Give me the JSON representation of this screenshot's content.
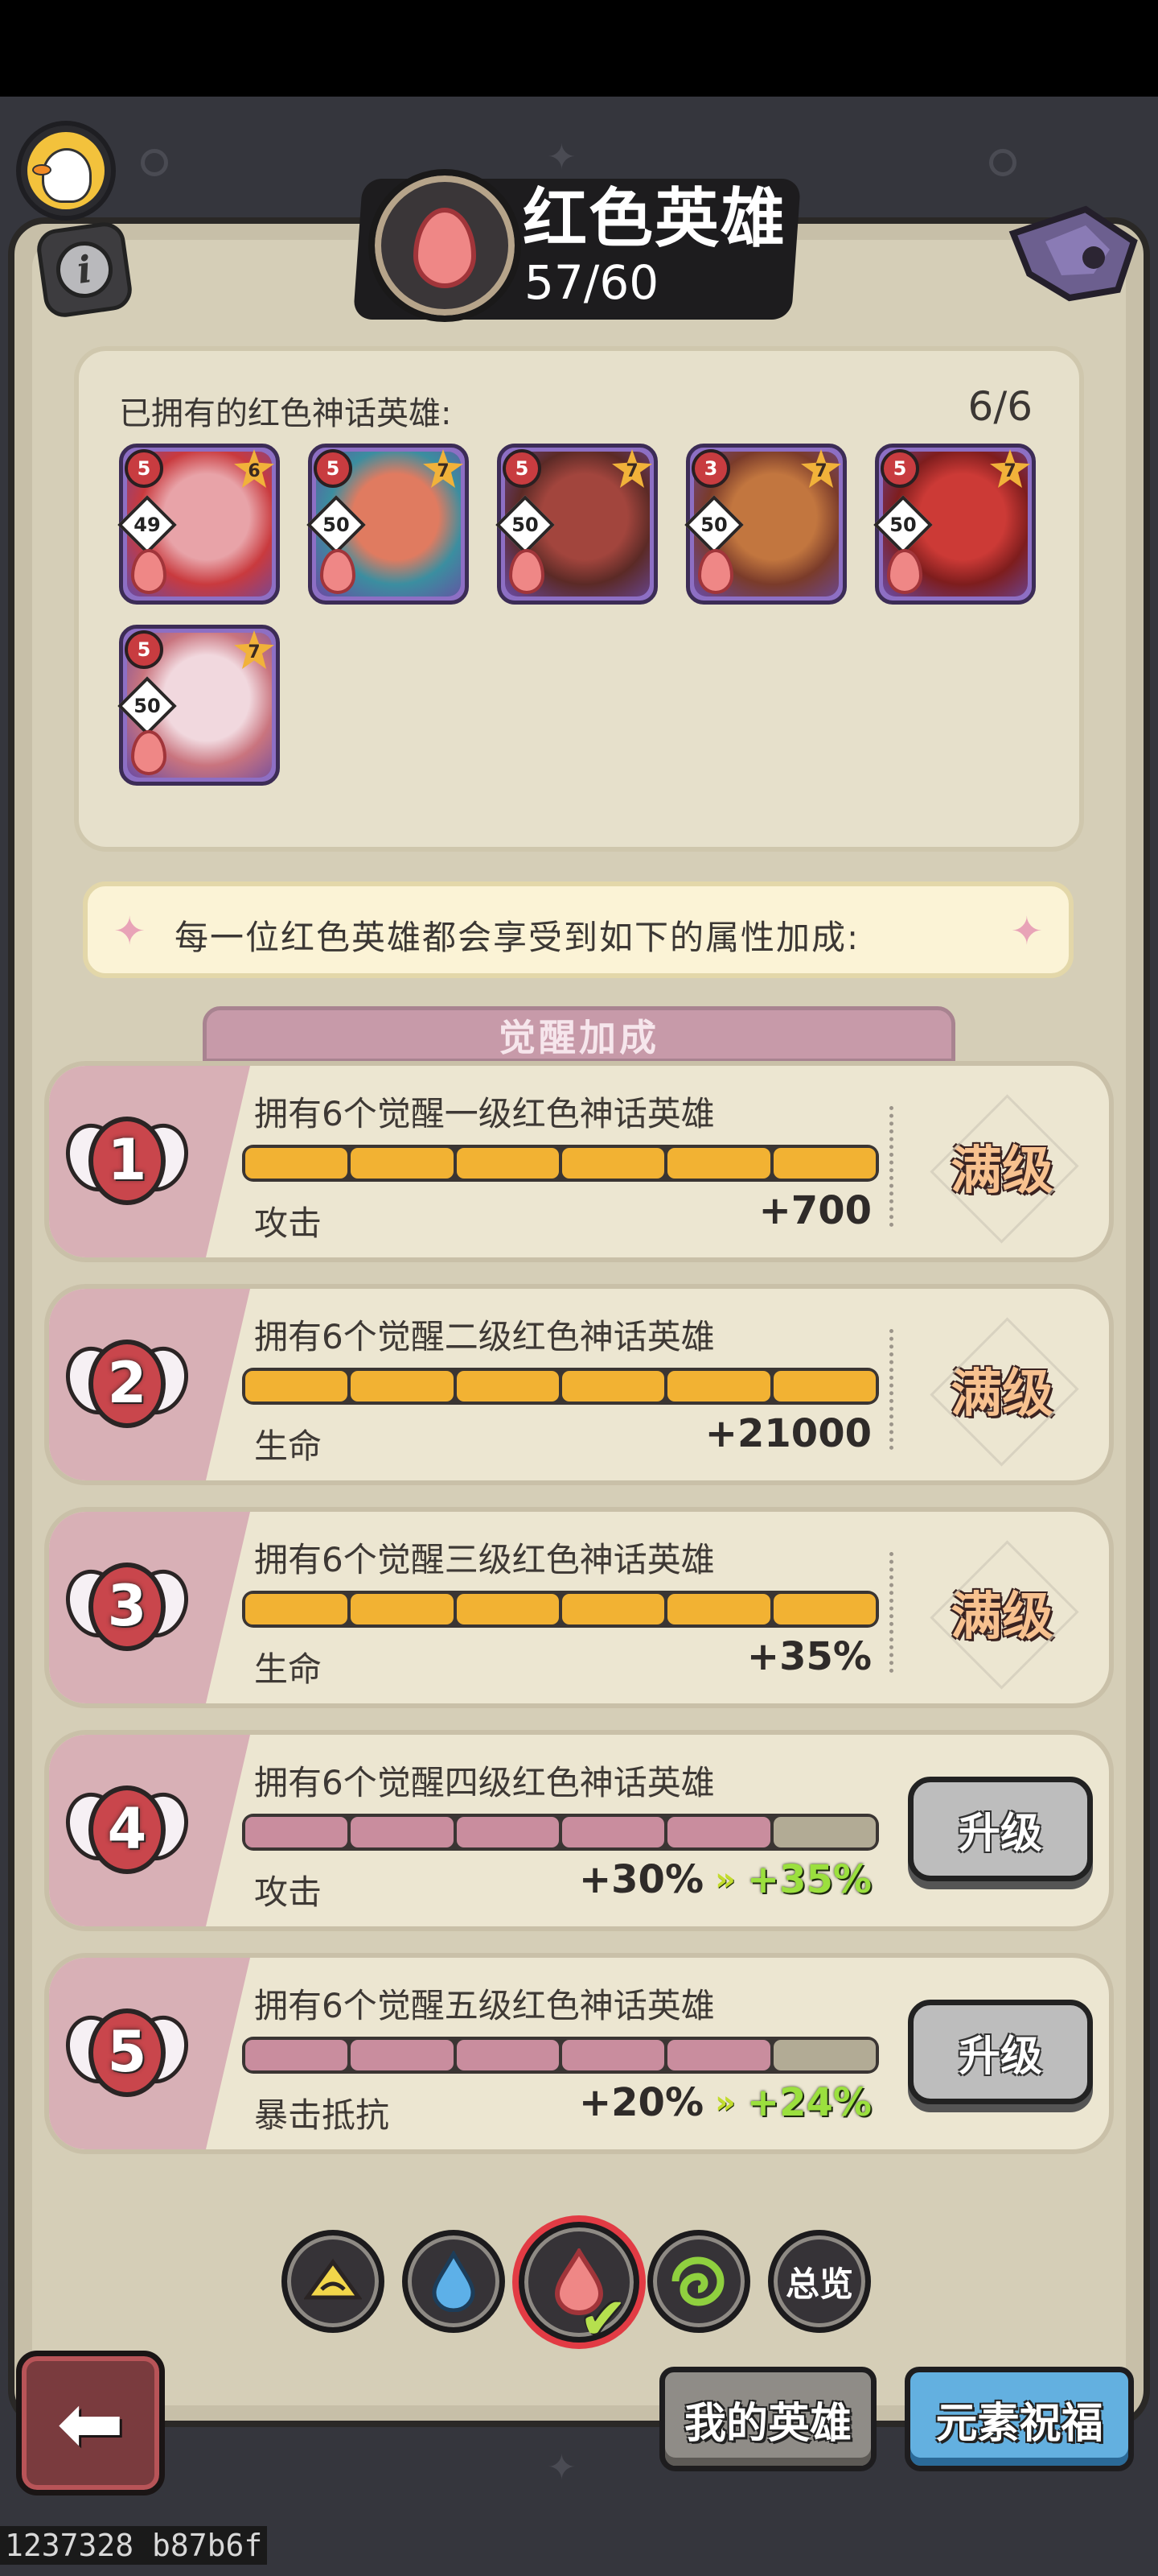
{
  "header": {
    "title": "红色英雄",
    "count": "57/60"
  },
  "owned": {
    "label": "已拥有的红色神话英雄:",
    "count": "6/6",
    "heroes": [
      {
        "awaken": "5",
        "stars": "6",
        "level": "49",
        "art": [
          "#e8a3a8",
          "#c93a3e"
        ]
      },
      {
        "awaken": "5",
        "stars": "7",
        "level": "50",
        "art": [
          "#e07b60",
          "#3b8ea0"
        ]
      },
      {
        "awaken": "5",
        "stars": "7",
        "level": "50",
        "art": [
          "#a2453d",
          "#5b2a26"
        ]
      },
      {
        "awaken": "3",
        "stars": "7",
        "level": "50",
        "art": [
          "#c2763f",
          "#7a3b2a"
        ]
      },
      {
        "awaken": "5",
        "stars": "7",
        "level": "50",
        "art": [
          "#cc3a36",
          "#7e1d1d"
        ]
      },
      {
        "awaken": "5",
        "stars": "7",
        "level": "50",
        "art": [
          "#f1d8de",
          "#c9747e"
        ]
      }
    ]
  },
  "banner": {
    "text": "每一位红色英雄都会享受到如下的属性加成:"
  },
  "section_title": "觉醒加成",
  "bonuses": [
    {
      "num": "1",
      "requirement": "拥有6个觉醒一级红色神话英雄",
      "filled": 6,
      "total": 6,
      "stat": "攻击",
      "value": "+700",
      "next": "",
      "status": "满级"
    },
    {
      "num": "2",
      "requirement": "拥有6个觉醒二级红色神话英雄",
      "filled": 6,
      "total": 6,
      "stat": "生命",
      "value": "+21000",
      "next": "",
      "status": "满级"
    },
    {
      "num": "3",
      "requirement": "拥有6个觉醒三级红色神话英雄",
      "filled": 6,
      "total": 6,
      "stat": "生命",
      "value": "+35%",
      "next": "",
      "status": "满级"
    },
    {
      "num": "4",
      "requirement": "拥有6个觉醒四级红色神话英雄",
      "filled": 5,
      "total": 6,
      "stat": "攻击",
      "value": "+30%",
      "next": "+35%",
      "status": "升级"
    },
    {
      "num": "5",
      "requirement": "拥有6个觉醒五级红色神话英雄",
      "filled": 5,
      "total": 6,
      "stat": "暴击抵抗",
      "value": "+20%",
      "next": "+24%",
      "status": "升级"
    }
  ],
  "element_tabs": [
    {
      "name": "yellow",
      "label": "",
      "color": "#f2d64a"
    },
    {
      "name": "blue",
      "label": "",
      "color": "#5db0e8"
    },
    {
      "name": "red",
      "label": "",
      "color": "#ef8786",
      "active": true
    },
    {
      "name": "green",
      "label": "",
      "color": "#8fd03f"
    },
    {
      "name": "overview",
      "label": "总览"
    }
  ],
  "nav": {
    "my_heroes": "我的英雄",
    "element_blessing": "元素祝福"
  },
  "footer": {
    "id": "1237328 b87b6f"
  },
  "colors": {
    "bar_filled_max": "#f2b233",
    "bar_filled": "#c98d9e",
    "bar_empty": "#b2ab95",
    "accent_red": "#e23b44"
  }
}
